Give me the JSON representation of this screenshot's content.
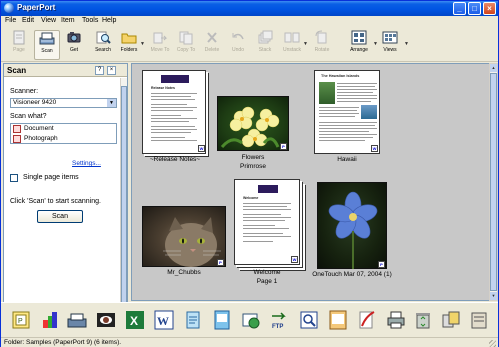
{
  "window": {
    "title": "PaperPort"
  },
  "menu": [
    "File",
    "Edit",
    "View",
    "Item",
    "Tools",
    "Help"
  ],
  "toolbar": [
    {
      "label": "Page",
      "icon": "page-icon",
      "enabled": false
    },
    {
      "label": "Scan",
      "icon": "scan-icon",
      "enabled": true,
      "active": true
    },
    {
      "label": "Get",
      "icon": "get-icon",
      "enabled": true
    },
    {
      "label": "Search",
      "icon": "search-icon",
      "enabled": true
    },
    {
      "label": "Folders",
      "icon": "folders-icon",
      "enabled": true
    },
    {
      "label": "Move To",
      "icon": "move-to-icon",
      "enabled": false
    },
    {
      "label": "Copy To",
      "icon": "copy-to-icon",
      "enabled": false
    },
    {
      "label": "Delete",
      "icon": "delete-icon",
      "enabled": false
    },
    {
      "label": "Undo",
      "icon": "undo-icon",
      "enabled": false
    },
    {
      "label": "Stack",
      "icon": "stack-icon",
      "enabled": false
    },
    {
      "label": "Unstack",
      "icon": "unstack-icon",
      "enabled": false
    },
    {
      "label": "Rotate",
      "icon": "rotate-icon",
      "enabled": false
    },
    {
      "label": "Arrange",
      "icon": "arrange-icon",
      "enabled": true
    },
    {
      "label": "Views",
      "icon": "views-icon",
      "enabled": true
    }
  ],
  "scan_pane": {
    "title": "Scan",
    "help": "?",
    "close": "×",
    "scanner_label": "Scanner:",
    "scanner_value": "Visioneer 9420",
    "scan_what_label": "Scan what?",
    "scan_what_options": [
      "Document",
      "Photograph"
    ],
    "settings_link": "Settings...",
    "single_page_label": "Single page items",
    "single_page_checked": false,
    "instruction": "Click 'Scan' to start scanning.",
    "scan_button": "Scan"
  },
  "items": [
    {
      "label": "~Release Notes~",
      "kind": "document"
    },
    {
      "label": "Flowers",
      "sublabel": "Primrose",
      "kind": "photo"
    },
    {
      "label": "Hawaii",
      "kind": "document"
    },
    {
      "label": "Mr_Chubbs",
      "kind": "photo"
    },
    {
      "label": "Welcome",
      "sublabel": "Page 1",
      "kind": "document"
    },
    {
      "label": "OneTouch Mar 07, 2004 (1)",
      "kind": "photo"
    }
  ],
  "thumb_text": {
    "release_title": "Release Notes",
    "hawaii_title": "The Hawaiian Islands",
    "welcome_title": "Welcome"
  },
  "app_bar": [
    "paperport-link-icon",
    "paint-icon",
    "scanner-app-icon",
    "photo-viewer-icon",
    "excel-icon",
    "word-icon",
    "notepad-icon",
    "pdf-reader-icon",
    "image-editor-icon",
    "ftp-icon",
    "ocr-icon",
    "acrobat-pdf-icon",
    "crop-icon",
    "printer-icon",
    "recycle-icon",
    "more-apps-icon"
  ],
  "status": "Folder: Samples (PaperPort 9) (6 items)."
}
